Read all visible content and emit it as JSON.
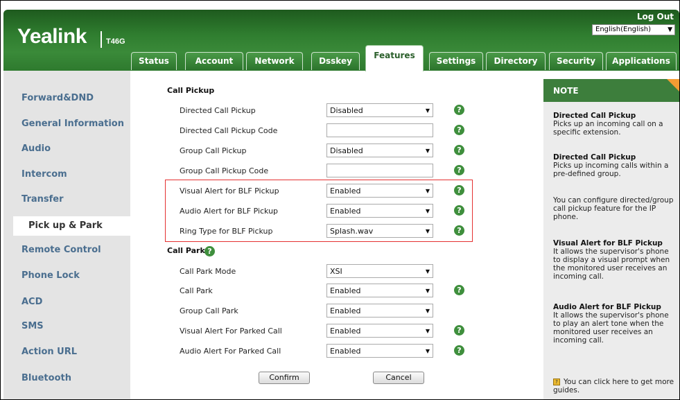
{
  "header": {
    "logo": "Yealink",
    "model": "T46G",
    "logout": "Log Out",
    "language": "English(English)"
  },
  "tabs": [
    {
      "label": "Status"
    },
    {
      "label": "Account"
    },
    {
      "label": "Network"
    },
    {
      "label": "Dsskey"
    },
    {
      "label": "Features"
    },
    {
      "label": "Settings"
    },
    {
      "label": "Directory"
    },
    {
      "label": "Security"
    },
    {
      "label": "Applications"
    }
  ],
  "sidebar": {
    "items": [
      {
        "label": "Forward&DND"
      },
      {
        "label": "General Information"
      },
      {
        "label": "Audio"
      },
      {
        "label": "Intercom"
      },
      {
        "label": "Transfer"
      },
      {
        "label": "Pick up & Park"
      },
      {
        "label": "Remote Control"
      },
      {
        "label": "Phone Lock"
      },
      {
        "label": "ACD"
      },
      {
        "label": "SMS"
      },
      {
        "label": "Action URL"
      },
      {
        "label": "Bluetooth"
      }
    ]
  },
  "call_pickup": {
    "title": "Call Pickup",
    "rows": [
      {
        "label": "Directed Call Pickup",
        "value": "Disabled"
      },
      {
        "label": "Directed Call Pickup Code",
        "value": ""
      },
      {
        "label": "Group Call Pickup",
        "value": "Disabled"
      },
      {
        "label": "Group Call Pickup Code",
        "value": ""
      },
      {
        "label": "Visual Alert for BLF Pickup",
        "value": "Enabled"
      },
      {
        "label": "Audio Alert for BLF Pickup",
        "value": "Enabled"
      },
      {
        "label": "Ring Type for BLF Pickup",
        "value": "Splash.wav"
      }
    ]
  },
  "call_park": {
    "title": "Call Park",
    "rows": [
      {
        "label": "Call Park Mode",
        "value": "XSI"
      },
      {
        "label": "Call Park",
        "value": "Enabled"
      },
      {
        "label": "Group Call Park",
        "value": "Enabled"
      },
      {
        "label": "Visual Alert For Parked Call",
        "value": "Enabled"
      },
      {
        "label": "Audio Alert For Parked Call",
        "value": "Enabled"
      }
    ]
  },
  "buttons": {
    "confirm": "Confirm",
    "cancel": "Cancel"
  },
  "note": {
    "title": "NOTE",
    "blocks": [
      {
        "heading": "Directed Call Pickup",
        "text": "Picks up an incoming call on a specific extension."
      },
      {
        "heading": "Directed Call Pickup",
        "text": "Picks up incoming calls within a pre-defined group."
      },
      {
        "heading": "",
        "text": "You can configure directed/group call pickup feature for the IP phone."
      },
      {
        "heading": "Visual Alert for BLF Pickup",
        "text": "It allows the supervisor's phone to display a visual prompt when the monitored user receives an incoming call."
      },
      {
        "heading": "Audio Alert for BLF Pickup",
        "text": "It allows the supervisor's phone to play an alert tone when the monitored user receives an incoming call."
      }
    ],
    "guide": "You can click here to get more guides."
  },
  "colors": {
    "header_green": "#2f7d2f",
    "note_header": "#3d7e3c",
    "highlight_red": "#e53030",
    "sidebar_link": "#4a6e8f"
  }
}
